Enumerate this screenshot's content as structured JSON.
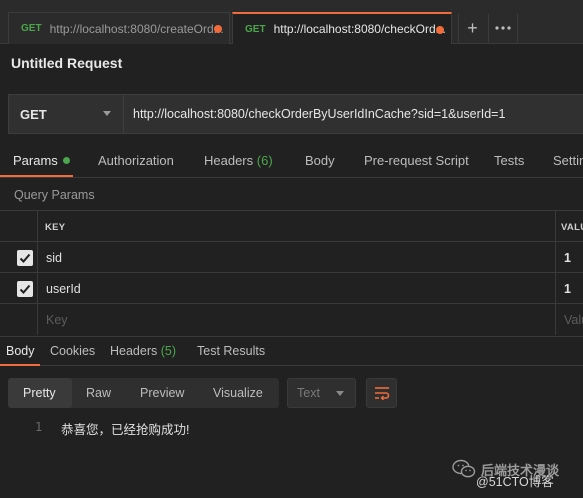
{
  "tabs": [
    {
      "method": "GET",
      "url": "http://localhost:8080/createOrd...",
      "modified": true,
      "active": false
    },
    {
      "method": "GET",
      "url": "http://localhost:8080/checkOrd...",
      "modified": true,
      "active": true
    }
  ],
  "tab_actions": {
    "new_tab_icon": "plus-icon",
    "more_icon": "ellipsis-icon"
  },
  "request": {
    "title": "Untitled Request",
    "method": "GET",
    "url": "http://localhost:8080/checkOrderByUserIdInCache?sid=1&userId=1"
  },
  "request_tabs": [
    {
      "label": "Params",
      "active": true
    },
    {
      "label": "Authorization"
    },
    {
      "label": "Headers",
      "count": "(6)"
    },
    {
      "label": "Body"
    },
    {
      "label": "Pre-request Script"
    },
    {
      "label": "Tests"
    },
    {
      "label": "Settin"
    }
  ],
  "query_params": {
    "title": "Query Params",
    "columns": {
      "key": "KEY",
      "value": "VALU"
    },
    "rows": [
      {
        "checked": true,
        "key": "sid",
        "value": "1"
      },
      {
        "checked": true,
        "key": "userId",
        "value": "1"
      }
    ],
    "placeholder": {
      "key": "Key",
      "value": "Valu"
    }
  },
  "response_tabs": [
    {
      "label": "Body",
      "active": true
    },
    {
      "label": "Cookies"
    },
    {
      "label": "Headers",
      "count": "(5)"
    },
    {
      "label": "Test Results"
    }
  ],
  "format": {
    "options": [
      "Pretty",
      "Raw",
      "Preview",
      "Visualize"
    ],
    "selected": "Pretty",
    "type": "Text",
    "wrap_icon": "wrap-lines-icon"
  },
  "response_body": {
    "line_number": "1",
    "text": "恭喜您，已经抢购成功!"
  },
  "watermark": {
    "title": "后端技术漫谈",
    "sub": "@51CTO博客",
    "icon": "wechat-icon"
  },
  "colors": {
    "accent": "#f26b3a",
    "method_get": "#4ca64c",
    "background": "#212121"
  }
}
